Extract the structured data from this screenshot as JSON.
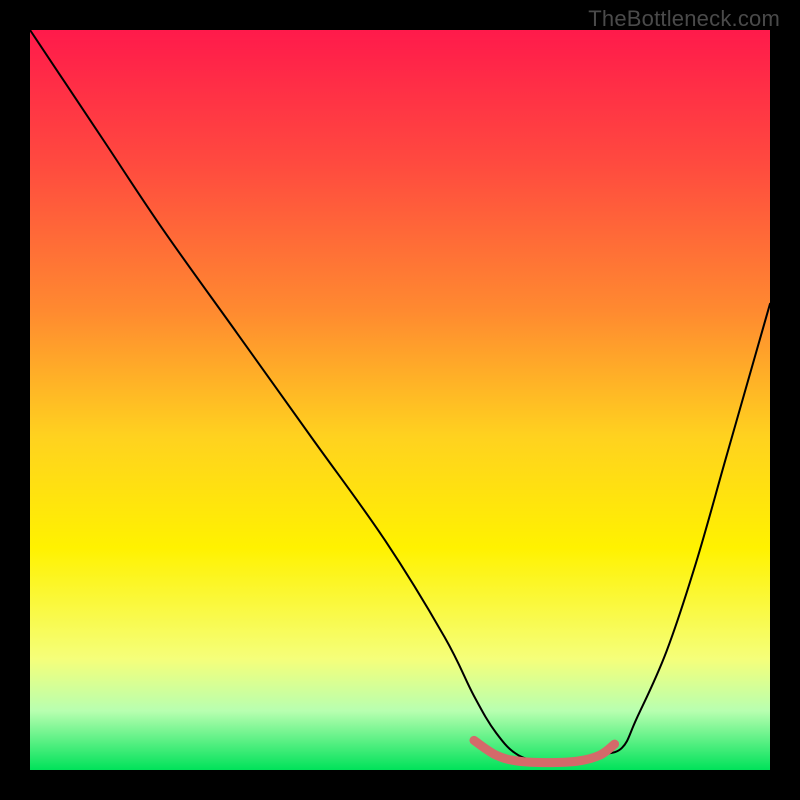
{
  "watermark": "TheBottleneck.com",
  "chart_data": {
    "type": "line",
    "title": "",
    "xlabel": "",
    "ylabel": "",
    "xlim": [
      0,
      100
    ],
    "ylim": [
      0,
      100
    ],
    "gradient_stops": [
      {
        "offset": 0,
        "color": "#ff1a4b"
      },
      {
        "offset": 18,
        "color": "#ff4a3f"
      },
      {
        "offset": 38,
        "color": "#ff8a30"
      },
      {
        "offset": 55,
        "color": "#ffd21f"
      },
      {
        "offset": 70,
        "color": "#fff200"
      },
      {
        "offset": 85,
        "color": "#f5ff7a"
      },
      {
        "offset": 92,
        "color": "#b8ffb0"
      },
      {
        "offset": 100,
        "color": "#00e25a"
      }
    ],
    "series": [
      {
        "name": "bottleneck-curve",
        "stroke": "#000000",
        "stroke_width": 2,
        "x": [
          0,
          4,
          10,
          18,
          28,
          38,
          48,
          56,
          60,
          63,
          66,
          70,
          74,
          77,
          80,
          82,
          86,
          90,
          94,
          98,
          100
        ],
        "y": [
          100,
          94,
          85,
          73,
          59,
          45,
          31,
          18,
          10,
          5,
          2,
          1,
          1,
          2,
          3,
          7,
          16,
          28,
          42,
          56,
          63
        ]
      },
      {
        "name": "highlight-valley",
        "stroke": "#d46a6a",
        "stroke_width": 9,
        "linecap": "round",
        "x": [
          60,
          63,
          66,
          70,
          74,
          77,
          79
        ],
        "y": [
          4.0,
          2.0,
          1.2,
          1.0,
          1.2,
          2.0,
          3.5
        ]
      }
    ]
  }
}
